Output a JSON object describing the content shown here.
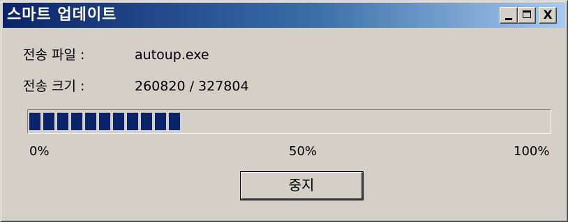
{
  "window": {
    "title": "스마트 업데이트",
    "controls": {
      "minimize_icon": "minimize-icon",
      "maximize_icon": "maximize-icon",
      "close_icon": "close-icon",
      "close_glyph": "X"
    }
  },
  "transfer": {
    "file_label": "전송 파일 :",
    "file_value": "autoup.exe",
    "size_label": "전송 크기 :",
    "size_value": "260820 / 327804"
  },
  "progress": {
    "fraction": 0.3,
    "block_count": 11,
    "ticks": [
      "0%",
      "50%",
      "100%"
    ],
    "fill_color": "#0a246a"
  },
  "buttons": {
    "stop_label": "중지"
  }
}
